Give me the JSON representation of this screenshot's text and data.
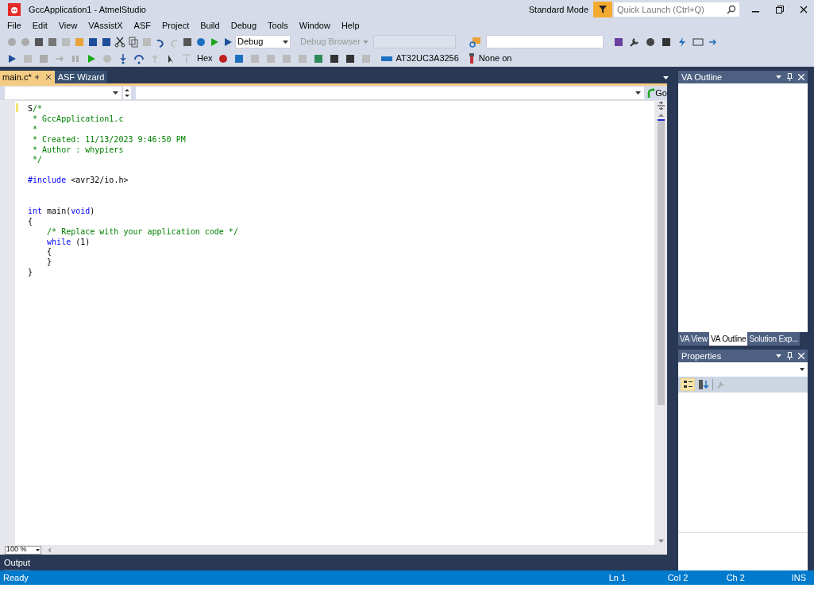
{
  "window": {
    "title": "GccApplication1 - AtmelStudio",
    "mode": "Standard Mode",
    "quick_launch": {
      "placeholder": "Quick Launch (Ctrl+Q)"
    }
  },
  "menu": [
    "File",
    "Edit",
    "View",
    "VAssistX",
    "ASF",
    "Project",
    "Build",
    "Debug",
    "Tools",
    "Window",
    "Help"
  ],
  "toolbar": {
    "configuration": "Debug",
    "debug_browser": "Debug Browser",
    "hex": "Hex",
    "device": "AT32UC3A3256",
    "tool": "None on"
  },
  "doc_tabs": [
    {
      "label": "main.c*",
      "selected": true
    },
    {
      "label": "ASF Wizard",
      "selected": false
    }
  ],
  "editor": {
    "go": "Go",
    "zoom": "100 %",
    "lines": [
      [
        [
          {
            "kind": "plain",
            "text": "S"
          },
          {
            "kind": "comment",
            "text": "/*"
          }
        ],
        [
          {
            "kind": "comment",
            "text": " * GccApplication1.c"
          }
        ],
        [
          {
            "kind": "comment",
            "text": " *"
          }
        ],
        [
          {
            "kind": "comment",
            "text": " * Created: 11/13/2023 9:46:50 PM"
          }
        ],
        [
          {
            "kind": "comment",
            "text": " * Author : whypiers"
          }
        ],
        [
          {
            "kind": "comment",
            "text": " */"
          }
        ]
      ],
      [
        [
          {
            "kind": "keyword",
            "text": "#include"
          },
          {
            "kind": "plain",
            "text": " <avr32/io.h>"
          }
        ]
      ],
      [
        [
          {
            "kind": "keyword",
            "text": "int"
          },
          {
            "kind": "plain",
            "text": " main("
          },
          {
            "kind": "keyword",
            "text": "void"
          },
          {
            "kind": "plain",
            "text": ")"
          }
        ],
        [
          {
            "kind": "plain",
            "text": "{"
          }
        ],
        [
          {
            "kind": "comment",
            "text": "    /* Replace with your application code */"
          }
        ],
        [
          {
            "kind": "keyword",
            "text": "    while"
          },
          {
            "kind": "plain",
            "text": " (1)"
          }
        ],
        [
          {
            "kind": "plain",
            "text": "    {"
          }
        ],
        [
          {
            "kind": "plain",
            "text": "    }"
          }
        ],
        [
          {
            "kind": "plain",
            "text": "}"
          }
        ]
      ]
    ]
  },
  "va_outline": {
    "title": "VA Outline",
    "tabs": [
      {
        "label": "VA View",
        "selected": false
      },
      {
        "label": "VA Outline",
        "selected": true
      },
      {
        "label": "Solution Exp...",
        "selected": false
      }
    ]
  },
  "properties": {
    "title": "Properties"
  },
  "output_tab": "Output",
  "status_bar": {
    "text": "Ready",
    "ln": "Ln 1",
    "col": "Col 2",
    "ch": "Ch 2",
    "mode": "INS"
  }
}
